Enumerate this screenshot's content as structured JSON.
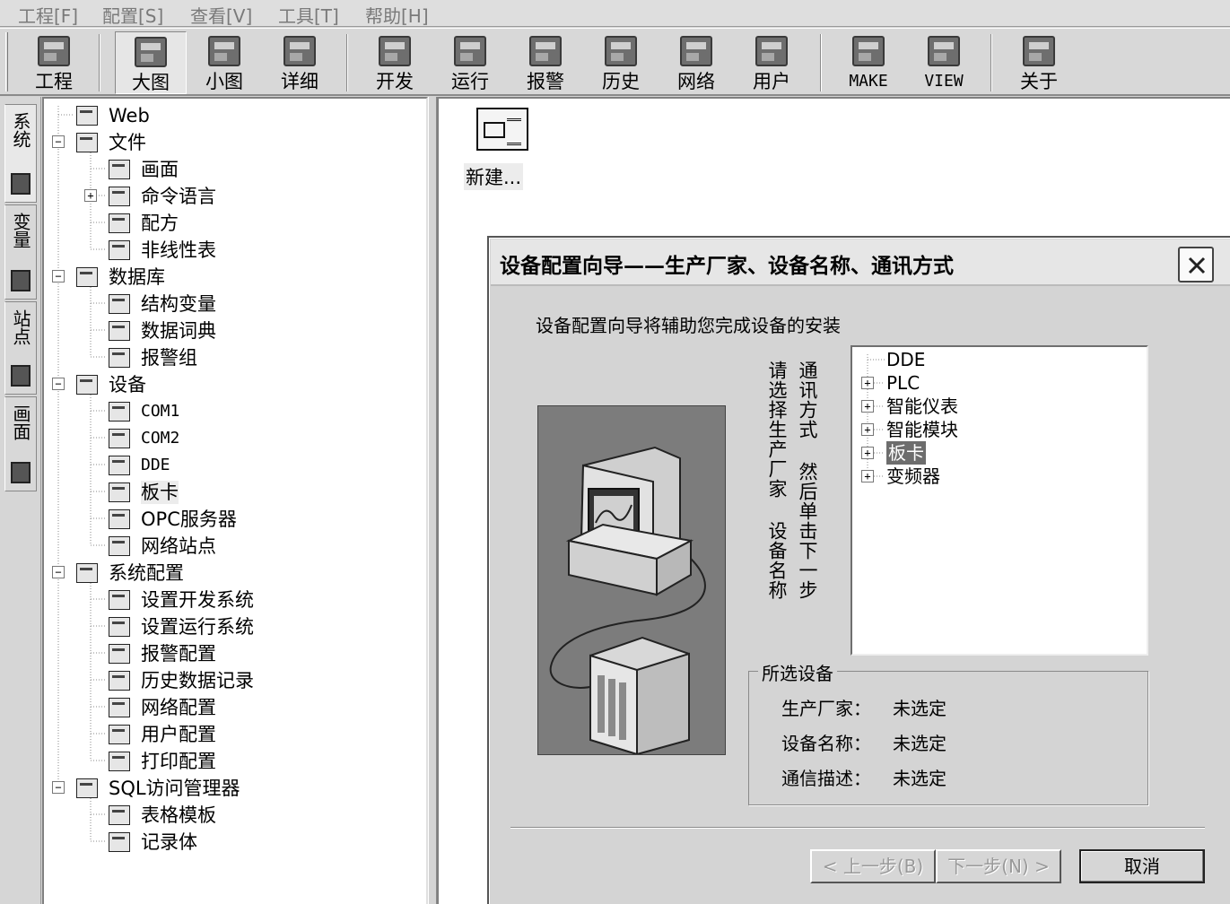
{
  "menu": [
    "工程[F]",
    "配置[S]",
    "查看[V]",
    "工具[T]",
    "帮助[H]"
  ],
  "toolbar": [
    {
      "label": "工程",
      "icon": "project-icon"
    },
    {
      "label": "大图",
      "icon": "large-icons-icon",
      "pressed": true
    },
    {
      "label": "小图",
      "icon": "small-icons-icon"
    },
    {
      "label": "详细",
      "icon": "details-icon"
    },
    {
      "label": "开发",
      "icon": "develop-icon"
    },
    {
      "label": "运行",
      "icon": "run-icon"
    },
    {
      "label": "报警",
      "icon": "alarm-icon"
    },
    {
      "label": "历史",
      "icon": "history-icon"
    },
    {
      "label": "网络",
      "icon": "network-icon"
    },
    {
      "label": "用户",
      "icon": "user-key-icon"
    },
    {
      "label": "MAKE",
      "icon": "make-icon"
    },
    {
      "label": "VIEW",
      "icon": "view-icon"
    },
    {
      "label": "关于",
      "icon": "about-icon"
    }
  ],
  "side_tabs": [
    {
      "label": "系统",
      "icon": "system-icon"
    },
    {
      "label": "变量",
      "icon": "variable-icon"
    },
    {
      "label": "站点",
      "icon": "station-icon"
    },
    {
      "label": "画面",
      "icon": "screen-icon"
    }
  ],
  "tree": [
    {
      "label": "Web",
      "level": 0,
      "icon": "folder-icon"
    },
    {
      "label": "文件",
      "level": 0,
      "icon": "folder-icon",
      "expander": "−"
    },
    {
      "label": "画面",
      "level": 1,
      "icon": "screen-icon"
    },
    {
      "label": "命令语言",
      "level": 1,
      "icon": "script-icon",
      "expander": "+"
    },
    {
      "label": "配方",
      "level": 1,
      "icon": "recipe-icon"
    },
    {
      "label": "非线性表",
      "level": 1,
      "icon": "nonlinear-table-icon"
    },
    {
      "label": "数据库",
      "level": 0,
      "icon": "database-icon",
      "expander": "−"
    },
    {
      "label": "结构变量",
      "level": 1,
      "icon": "struct-variable-icon"
    },
    {
      "label": "数据词典",
      "level": 1,
      "icon": "dictionary-icon"
    },
    {
      "label": "报警组",
      "level": 1,
      "icon": "alarm-group-icon"
    },
    {
      "label": "设备",
      "level": 0,
      "icon": "devices-icon",
      "expander": "−"
    },
    {
      "label": "COM1",
      "level": 1,
      "icon": "serial-port-icon"
    },
    {
      "label": "COM2",
      "level": 1,
      "icon": "serial-port-icon"
    },
    {
      "label": "DDE",
      "level": 1,
      "icon": "dde-icon"
    },
    {
      "label": "板卡",
      "level": 1,
      "icon": "board-card-icon",
      "selected": true
    },
    {
      "label": "OPC服务器",
      "level": 1,
      "icon": "opc-icon"
    },
    {
      "label": "网络站点",
      "level": 1,
      "icon": "network-station-icon"
    },
    {
      "label": "系统配置",
      "level": 0,
      "icon": "tools-icon",
      "expander": "−"
    },
    {
      "label": "设置开发系统",
      "level": 1,
      "icon": "dev-settings-icon"
    },
    {
      "label": "设置运行系统",
      "level": 1,
      "icon": "run-settings-icon"
    },
    {
      "label": "报警配置",
      "level": 1,
      "icon": "alarm-config-icon"
    },
    {
      "label": "历史数据记录",
      "level": 1,
      "icon": "history-record-icon"
    },
    {
      "label": "网络配置",
      "level": 1,
      "icon": "network-config-icon"
    },
    {
      "label": "用户配置",
      "level": 1,
      "icon": "user-config-icon"
    },
    {
      "label": "打印配置",
      "level": 1,
      "icon": "print-config-icon"
    },
    {
      "label": "SQL访问管理器",
      "level": 0,
      "icon": "sql-icon",
      "expander": "−"
    },
    {
      "label": "表格模板",
      "level": 1,
      "icon": "table-template-icon"
    },
    {
      "label": "记录体",
      "level": 1,
      "icon": "record-icon"
    }
  ],
  "content": {
    "new_label": "新建..."
  },
  "dialog": {
    "title": "设备配置向导——生产厂家、设备名称、通讯方式",
    "intro": "设备配置向导将辅助您完成设备的安装",
    "instruction_lines": [
      "请选择生产厂家",
      "设备名称",
      "通讯方式",
      "然后单击下一步"
    ],
    "device_tree": [
      {
        "label": "DDE",
        "expander": ""
      },
      {
        "label": "PLC",
        "expander": "+"
      },
      {
        "label": "智能仪表",
        "expander": "+"
      },
      {
        "label": "智能模块",
        "expander": "+"
      },
      {
        "label": "板卡",
        "expander": "+",
        "selected": true
      },
      {
        "label": "变频器",
        "expander": "+"
      }
    ],
    "selected_group": {
      "title": "所选设备",
      "rows": [
        {
          "label": "生产厂家：",
          "value": "未选定"
        },
        {
          "label": "设备名称：",
          "value": "未选定"
        },
        {
          "label": "通信描述：",
          "value": "未选定"
        }
      ]
    },
    "buttons": {
      "prev": "< 上一步(B)",
      "next": "下一步(N) >",
      "cancel": "取消"
    }
  }
}
